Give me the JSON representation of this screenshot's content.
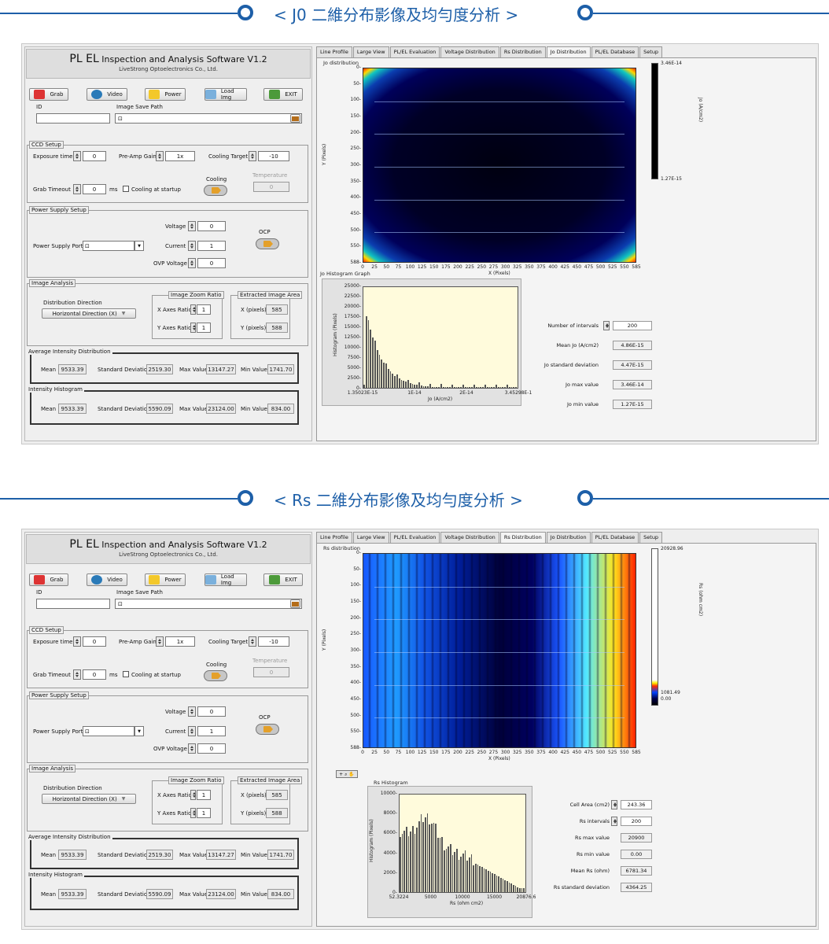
{
  "headings": {
    "jo": "< J0 二維分布影像及均勻度分析 >",
    "rs": "< Rs 二維分布影像及均勻度分析 >"
  },
  "app": {
    "title_main": "PL EL",
    "title_rest": " Inspection and Analysis Software V1.2",
    "subtitle": "LiveStrong Optoelectronics Co., Ltd.",
    "buttons": {
      "grab": "Grab",
      "video": "Video",
      "power": "Power",
      "load": "Load Img",
      "exit": "EXIT"
    },
    "id_label": "ID",
    "id_value": "",
    "save_path_label": "Image Save Path",
    "save_path_value": "",
    "ccd": {
      "title": "CCD Setup",
      "exposure_label": "Exposure time",
      "exposure_value": "0",
      "gain_label": "Pre-Amp Gain",
      "gain_value": "1x",
      "cooling_target_label": "Cooling Target",
      "cooling_target_value": "-10",
      "grab_timeout_label": "Grab Timeout",
      "grab_timeout_value": "0",
      "ms": "ms",
      "cooling_startup_label": "Cooling at startup",
      "cooling_label": "Cooling",
      "temperature_label": "Temperature",
      "temperature_value": "0"
    },
    "power": {
      "title": "Power Supply Setup",
      "port_label": "Power Supply Port",
      "voltage_label": "Voltage",
      "voltage_value": "0",
      "current_label": "Current",
      "current_value": "1",
      "ovp_label": "OVP Voltage",
      "ovp_value": "0",
      "ocp_label": "OCP"
    },
    "analysis": {
      "title": "Image Analysis",
      "direction_label": "Distribution Direction",
      "direction_value": "Horizontal Direction (X)",
      "zoom_title": "Image Zoom Ratio",
      "x_ratio_label": "X Axes Ratio",
      "x_ratio_value": "1",
      "y_ratio_label": "Y Axes Ratio",
      "y_ratio_value": "1",
      "area_title": "Extracted Image Area",
      "x_px_label": "X (pixels)",
      "x_px_value": "585",
      "y_px_label": "Y (pixels)",
      "y_px_value": "588"
    },
    "avg": {
      "title": "Average Intensity Distribution",
      "mean_label": "Mean",
      "mean": "9533.39",
      "std_label": "Standard Deviation",
      "std": "2519.30",
      "max_label": "Max Value",
      "max": "13147.27",
      "min_label": "Min Value",
      "min": "1741.70"
    },
    "hist": {
      "title": "Intensity Histogram",
      "mean_label": "Mean",
      "mean": "9533.39",
      "std_label": "Standard Deviation",
      "std": "5590.09",
      "max_label": "Max Value",
      "max": "23124.00",
      "min_label": "Min Value",
      "min": "834.00"
    }
  },
  "tabs_top": [
    "Line Profile",
    "Large View",
    "PL/EL Evaluation",
    "Voltage Distribution",
    "Rs Distribution",
    "Jo Distribution",
    "PL/EL Database",
    "Setup"
  ],
  "tabs_bottom": [
    "Line Profile",
    "Large View",
    "PL/EL Evaluation",
    "Voltage Distribution",
    "Rs Distribution",
    "Jo Distribution",
    "PL/EL Database",
    "Setup"
  ],
  "jo": {
    "plot_title": "Jo distribution",
    "y_label": "Y (Pixels)",
    "x_label": "X (Pixels)",
    "y_ticks": [
      "0-",
      "50-",
      "100-",
      "150-",
      "200-",
      "250-",
      "300-",
      "350-",
      "400-",
      "450-",
      "500-",
      "550-",
      "588-"
    ],
    "x_ticks": [
      "0",
      "25",
      "50",
      "75",
      "100",
      "125",
      "150",
      "175",
      "200",
      "225",
      "250",
      "275",
      "300",
      "325",
      "350",
      "375",
      "400",
      "425",
      "450",
      "475",
      "500",
      "525",
      "550",
      "585"
    ],
    "cbar_max": "3.46E-14",
    "cbar_min": "1.27E-15",
    "cbar_label": "Jo (A/cm2)",
    "hist_title": "Jo Histogram Graph",
    "hist_ylabel": "Histogram (Pixels)",
    "hist_xlabel": "Jo (A/cm2)",
    "hist_y_ticks": [
      "25000-",
      "22500-",
      "20000-",
      "17500-",
      "15000-",
      "12500-",
      "10000-",
      "7500-",
      "5000-",
      "2500-",
      "0-"
    ],
    "hist_x_ticks": [
      "1.35023E-15",
      "1E-14",
      "2E-14",
      "3.45298E-1"
    ],
    "stats": [
      {
        "label": "Number of intervals",
        "value": "200"
      },
      {
        "label": "Mean Jo (A/cm2)",
        "value": "4.86E-15"
      },
      {
        "label": "Jo standard deviation",
        "value": "4.47E-15"
      },
      {
        "label": "Jo max value",
        "value": "3.46E-14"
      },
      {
        "label": "Jo min value",
        "value": "1.27E-15"
      }
    ]
  },
  "rs": {
    "plot_title": "Rs distribution",
    "y_label": "Y (Pixels)",
    "x_label": "X (Pixels)",
    "y_ticks": [
      "0-",
      "50-",
      "100-",
      "150-",
      "200-",
      "250-",
      "300-",
      "350-",
      "400-",
      "450-",
      "500-",
      "550-",
      "588-"
    ],
    "x_ticks": [
      "0",
      "25",
      "50",
      "75",
      "100",
      "125",
      "150",
      "175",
      "200",
      "225",
      "250",
      "275",
      "300",
      "325",
      "350",
      "375",
      "400",
      "425",
      "450",
      "475",
      "500",
      "525",
      "550",
      "585"
    ],
    "cbar_max": "20928.96",
    "cbar_mid": "1081.49",
    "cbar_min": "0.00",
    "cbar_label": "Rs (ohm cm2)",
    "hist_title": "Rs Histogram",
    "hist_ylabel": "Histogram (Pixels)",
    "hist_xlabel": "Rs (ohm cm2)",
    "hist_y_ticks": [
      "10000-",
      "8000-",
      "6000-",
      "4000-",
      "2000-",
      "0-"
    ],
    "hist_x_ticks": [
      "52.3224",
      "5000",
      "10000",
      "15000",
      "20876.6"
    ],
    "stats": [
      {
        "label": "Cell Area (cm2)",
        "value": "243.36"
      },
      {
        "label": "Rs intervals",
        "value": "200"
      },
      {
        "label": "Rs max value",
        "value": "20900"
      },
      {
        "label": "Rs min value",
        "value": "0.00"
      },
      {
        "label": "Mean Rs (ohm)",
        "value": "6781.34"
      },
      {
        "label": "Rs standard deviation",
        "value": "4364.25"
      }
    ]
  },
  "colors": {
    "accent": "#1d5fa8",
    "histogram_bg": "#fffbdc"
  }
}
